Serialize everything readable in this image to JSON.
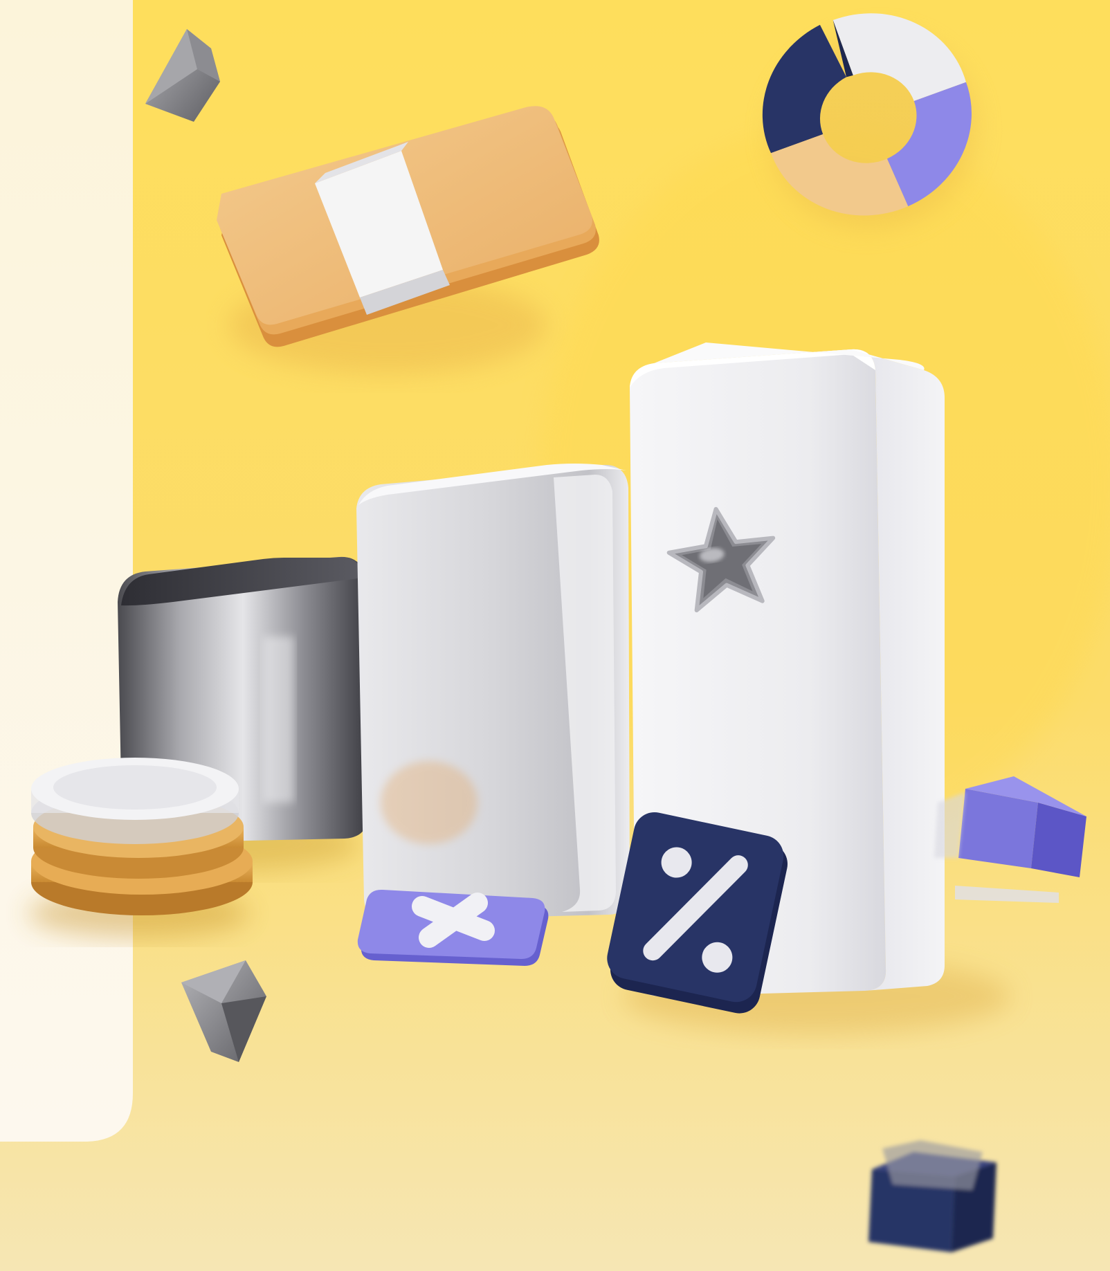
{
  "scene": {
    "kind": "3d-finance-illustration",
    "objects": [
      "side-panel",
      "gray-gem-top",
      "money-stack",
      "donut-chart",
      "dark-chrome-cube",
      "silver-pillar",
      "white-pillar",
      "chrome-star",
      "coin-stack",
      "purple-x-tile",
      "navy-percent-tile",
      "purple-block",
      "gray-gem-bottom",
      "navy-box"
    ]
  },
  "colors": {
    "background_top": "#FEDE5C",
    "background_bottom": "#F7E7B0",
    "panel": "#FCF7EA",
    "money": "#F0BC78",
    "band": "#F2F2F2",
    "navy": "#283466",
    "lavender": "#8E88E8",
    "peach": "#F2C98C",
    "white_block": "#F1F1F3",
    "chrome": "#9A9A9E",
    "gold": "#D9A148"
  },
  "icons": {
    "percent_tile": "percent-icon",
    "x_tile": "x-icon",
    "star": "star-icon"
  }
}
